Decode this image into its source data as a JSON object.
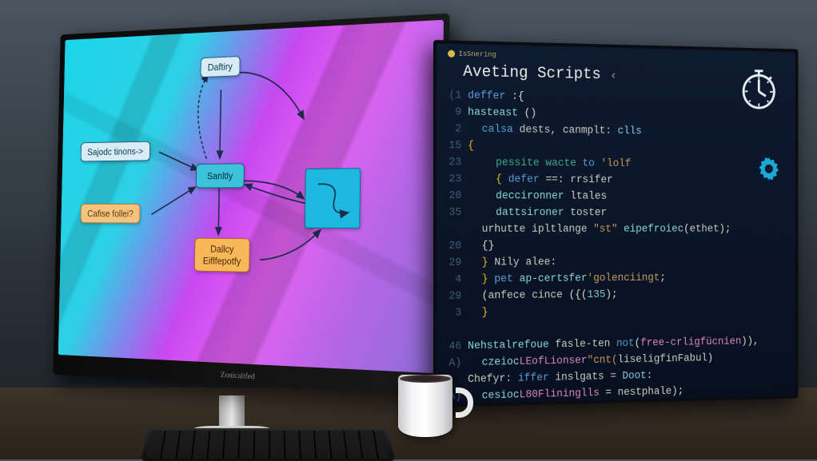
{
  "leftMonitor": {
    "brand": "Zonicaltfed",
    "diagram": {
      "nodes": {
        "top": "Daftiry",
        "left1": "Sajodc tinons->",
        "center": "Sanltly",
        "left2": "Cafise follei?",
        "bottom_line1": "Dallcy",
        "bottom_line2": "Eiflfepotfy"
      }
    }
  },
  "rightMonitor": {
    "titlebar": "IsSnering",
    "tabTitle": "Aveting Scripts",
    "gutter": [
      "(1",
      "9",
      "2",
      "15",
      "23",
      "23",
      "20",
      "35",
      "",
      "20",
      "29",
      "4",
      "29",
      "3",
      "",
      "46",
      "A)",
      "",
      "A)"
    ],
    "code": [
      {
        "indent": 0,
        "spans": [
          {
            "c": "t-kw",
            "t": "deffer"
          },
          {
            "c": "t-op",
            "t": " :{"
          }
        ]
      },
      {
        "indent": 0,
        "spans": [
          {
            "c": "t-fn",
            "t": "hasteast"
          },
          {
            "c": "t-op",
            "t": " ()"
          }
        ]
      },
      {
        "indent": 1,
        "spans": [
          {
            "c": "t-kw",
            "t": "calsa"
          },
          {
            "c": "t-id",
            "t": " dests, "
          },
          {
            "c": "t-id",
            "t": "canmplt: "
          },
          {
            "c": "t-var",
            "t": "clls"
          }
        ]
      },
      {
        "indent": 0,
        "spans": [
          {
            "c": "t-br",
            "t": "{"
          }
        ]
      },
      {
        "indent": 2,
        "spans": [
          {
            "c": "t-green",
            "t": "pessite wacte "
          },
          {
            "c": "t-kw",
            "t": "to"
          },
          {
            "c": "t-str",
            "t": " 'lolf"
          }
        ]
      },
      {
        "indent": 2,
        "spans": [
          {
            "c": "t-br",
            "t": "{ "
          },
          {
            "c": "t-kw",
            "t": "defer"
          },
          {
            "c": "t-op",
            "t": " ==: "
          },
          {
            "c": "t-id",
            "t": "rrsifer"
          }
        ]
      },
      {
        "indent": 2,
        "spans": [
          {
            "c": "t-fn",
            "t": "deccironner"
          },
          {
            "c": "t-id",
            "t": " ltales"
          }
        ]
      },
      {
        "indent": 2,
        "spans": [
          {
            "c": "t-fn",
            "t": "dattsironer"
          },
          {
            "c": "t-id",
            "t": " toster"
          }
        ]
      },
      {
        "indent": 1,
        "spans": [
          {
            "c": "t-id",
            "t": "urhutte ipltlange "
          },
          {
            "c": "t-str",
            "t": "\"st\""
          },
          {
            "c": "t-fn",
            "t": " eipefroiec"
          },
          {
            "c": "t-op",
            "t": "("
          },
          {
            "c": "t-id",
            "t": "ethet"
          },
          {
            "c": "t-op",
            "t": ");"
          }
        ]
      },
      {
        "indent": 1,
        "spans": [
          {
            "c": "t-op",
            "t": "{}"
          }
        ]
      },
      {
        "indent": 1,
        "spans": [
          {
            "c": "t-br",
            "t": "} "
          },
          {
            "c": "t-id",
            "t": "Nily alee:"
          }
        ]
      },
      {
        "indent": 1,
        "spans": [
          {
            "c": "t-br",
            "t": "} "
          },
          {
            "c": "t-kw",
            "t": "pet"
          },
          {
            "c": "t-fn",
            "t": " ap-certsfer"
          },
          {
            "c": "t-str",
            "t": "'golenciingt"
          },
          {
            "c": "t-op",
            "t": ";"
          }
        ]
      },
      {
        "indent": 1,
        "spans": [
          {
            "c": "t-op",
            "t": "("
          },
          {
            "c": "t-id",
            "t": "anfece cince "
          },
          {
            "c": "t-op",
            "t": "({("
          },
          {
            "c": "t-num",
            "t": "135"
          },
          {
            "c": "t-op",
            "t": ");"
          }
        ]
      },
      {
        "indent": 1,
        "spans": [
          {
            "c": "t-br",
            "t": "}"
          }
        ]
      },
      {
        "indent": 0,
        "spans": [
          {
            "c": "",
            "t": ""
          }
        ]
      },
      {
        "indent": 0,
        "spans": [
          {
            "c": "t-fn",
            "t": "Nehstalrefoue"
          },
          {
            "c": "t-id",
            "t": " fasle-ten "
          },
          {
            "c": "t-kw",
            "t": "not"
          },
          {
            "c": "t-op",
            "t": "("
          },
          {
            "c": "t-pink",
            "t": "free-crligfücnien"
          },
          {
            "c": "t-op",
            "t": ")),"
          }
        ]
      },
      {
        "indent": 1,
        "spans": [
          {
            "c": "t-fn",
            "t": "czeioc"
          },
          {
            "c": "t-pink",
            "t": "LEofLionser"
          },
          {
            "c": "t-str",
            "t": "\"cnt("
          },
          {
            "c": "t-id",
            "t": "liseligfinFabul"
          },
          {
            "c": "t-op",
            "t": ")"
          }
        ]
      },
      {
        "indent": 0,
        "spans": [
          {
            "c": "t-id",
            "t": "Chefyr: "
          },
          {
            "c": "t-kw",
            "t": "iffer"
          },
          {
            "c": "t-id",
            "t": " inslgats = "
          },
          {
            "c": "t-var",
            "t": "Doot"
          },
          {
            "c": "t-op",
            "t": ":"
          }
        ]
      },
      {
        "indent": 1,
        "spans": [
          {
            "c": "t-fn",
            "t": "cesioc"
          },
          {
            "c": "t-pink",
            "t": "L80Flininglls"
          },
          {
            "c": "t-op",
            "t": " = "
          },
          {
            "c": "t-id",
            "t": "nestphale"
          },
          {
            "c": "t-op",
            "t": ");"
          }
        ]
      }
    ]
  }
}
